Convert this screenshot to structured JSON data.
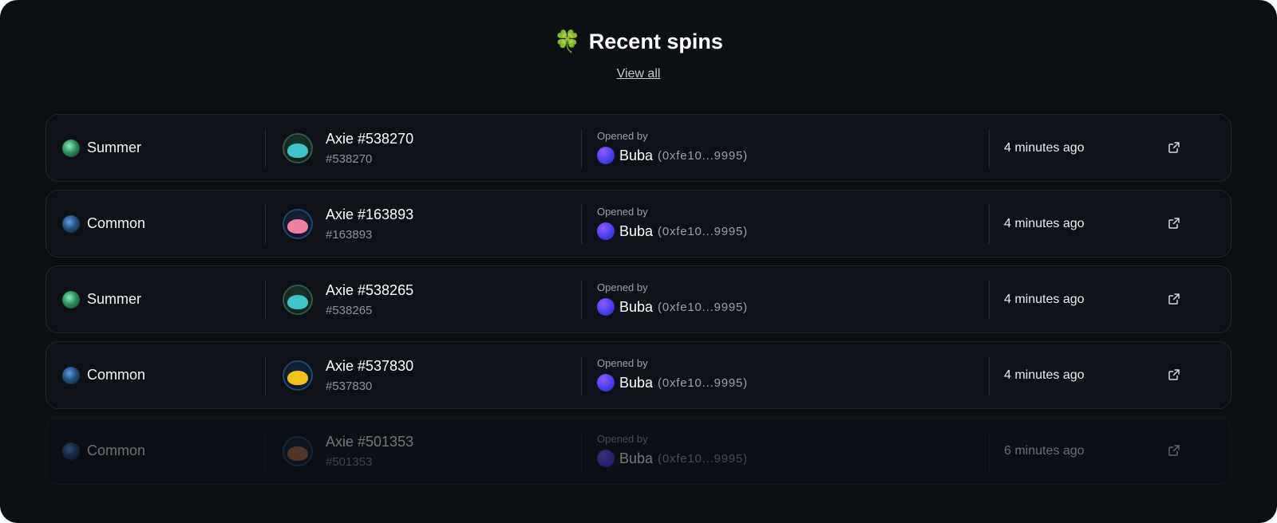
{
  "header": {
    "emoji": "🍀",
    "title": "Recent spins",
    "view_all": "View all"
  },
  "spins": [
    {
      "rarity": "Summer",
      "rarity_color": "#3fb578",
      "axie_name": "Axie #538270",
      "axie_id": "#538270",
      "axie_color": "#3ec5c9",
      "opened_by_label": "Opened by",
      "user": "Buba",
      "wallet": "(0xfe10...9995)",
      "time": "4 minutes ago"
    },
    {
      "rarity": "Common",
      "rarity_color": "#3a78c4",
      "axie_name": "Axie #163893",
      "axie_id": "#163893",
      "axie_color": "#f07fa2",
      "opened_by_label": "Opened by",
      "user": "Buba",
      "wallet": "(0xfe10...9995)",
      "time": "4 minutes ago"
    },
    {
      "rarity": "Summer",
      "rarity_color": "#3fb578",
      "axie_name": "Axie #538265",
      "axie_id": "#538265",
      "axie_color": "#3ec5c9",
      "opened_by_label": "Opened by",
      "user": "Buba",
      "wallet": "(0xfe10...9995)",
      "time": "4 minutes ago"
    },
    {
      "rarity": "Common",
      "rarity_color": "#3a78c4",
      "axie_name": "Axie #537830",
      "axie_id": "#537830",
      "axie_color": "#f5c21b",
      "opened_by_label": "Opened by",
      "user": "Buba",
      "wallet": "(0xfe10...9995)",
      "time": "4 minutes ago"
    },
    {
      "rarity": "Common",
      "rarity_color": "#3a78c4",
      "axie_name": "Axie #501353",
      "axie_id": "#501353",
      "axie_color": "#b06a3a",
      "opened_by_label": "Opened by",
      "user": "Buba",
      "wallet": "(0xfe10...9995)",
      "time": "6 minutes ago"
    }
  ],
  "icons": {
    "external_link": "external-link-icon",
    "clover": "four-leaf-clover-icon"
  },
  "colors": {
    "background": "#0c0f14",
    "row_border": "#23272f",
    "user_avatar": "#5b3ff5"
  }
}
